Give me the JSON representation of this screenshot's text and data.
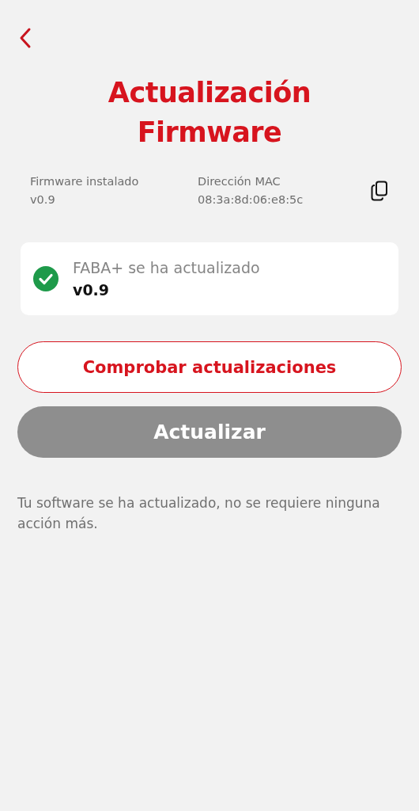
{
  "header": {
    "title_lines": [
      "Actualización",
      "Firmware"
    ]
  },
  "info": [
    {
      "label": "Firmware instalado",
      "value": "v0.9"
    },
    {
      "label": "Dirección MAC",
      "value": "08:3a:8d:06:e8:5c"
    }
  ],
  "status_card": {
    "updated": true,
    "message": "FABA+ se ha actualizado",
    "version": "v0.9"
  },
  "buttons": [
    {
      "label": "Comprobar actualizaciones",
      "kind": "outline",
      "disabled": false
    },
    {
      "label": "Actualizar",
      "kind": "filled",
      "disabled": true
    }
  ],
  "note": "Tu software se ha actualizado, no se requiere ninguna acción más."
}
